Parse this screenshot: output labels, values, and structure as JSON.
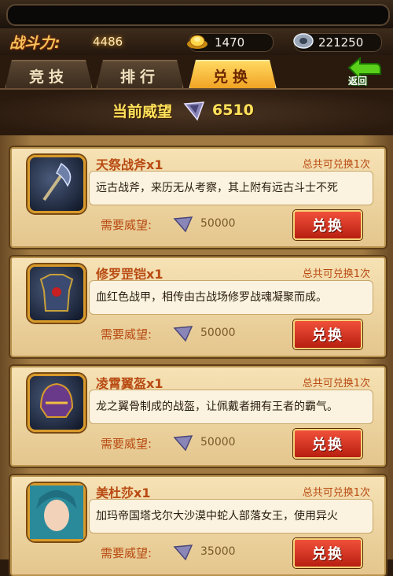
{
  "header": {
    "power_label": "战斗力:",
    "power_value": "4486",
    "gold": "1470",
    "gems": "221250"
  },
  "tabs": [
    {
      "label": "竞技"
    },
    {
      "label": "排行"
    },
    {
      "label": "兑换"
    }
  ],
  "back_label": "返回",
  "reputation": {
    "label": "当前威望",
    "value": "6510"
  },
  "need_label": "需要威望:",
  "exchange_label": "兑换",
  "items": [
    {
      "name": "天祭战斧x1",
      "limit": "总共可兑换1次",
      "desc": "远古战斧，来历无从考察，其上附有远古斗士不死",
      "cost": "50000"
    },
    {
      "name": "修罗罡铠x1",
      "limit": "总共可兑换1次",
      "desc": "血红色战甲，相传由古战场修罗战魂凝聚而成。",
      "cost": "50000"
    },
    {
      "name": "凌霄翼盔x1",
      "limit": "总共可兑换1次",
      "desc": "龙之翼骨制成的战盔，让佩戴者拥有王者的霸气。",
      "cost": "50000"
    },
    {
      "name": "美杜莎x1",
      "limit": "总共可兑换1次",
      "desc": "加玛帝国塔戈尔大沙漠中蛇人部落女王，使用异火",
      "cost": "35000"
    }
  ],
  "colors": {
    "accent_gold": "#ffe25a",
    "button_red": "#d8301c",
    "item_title": "#b84a12"
  }
}
